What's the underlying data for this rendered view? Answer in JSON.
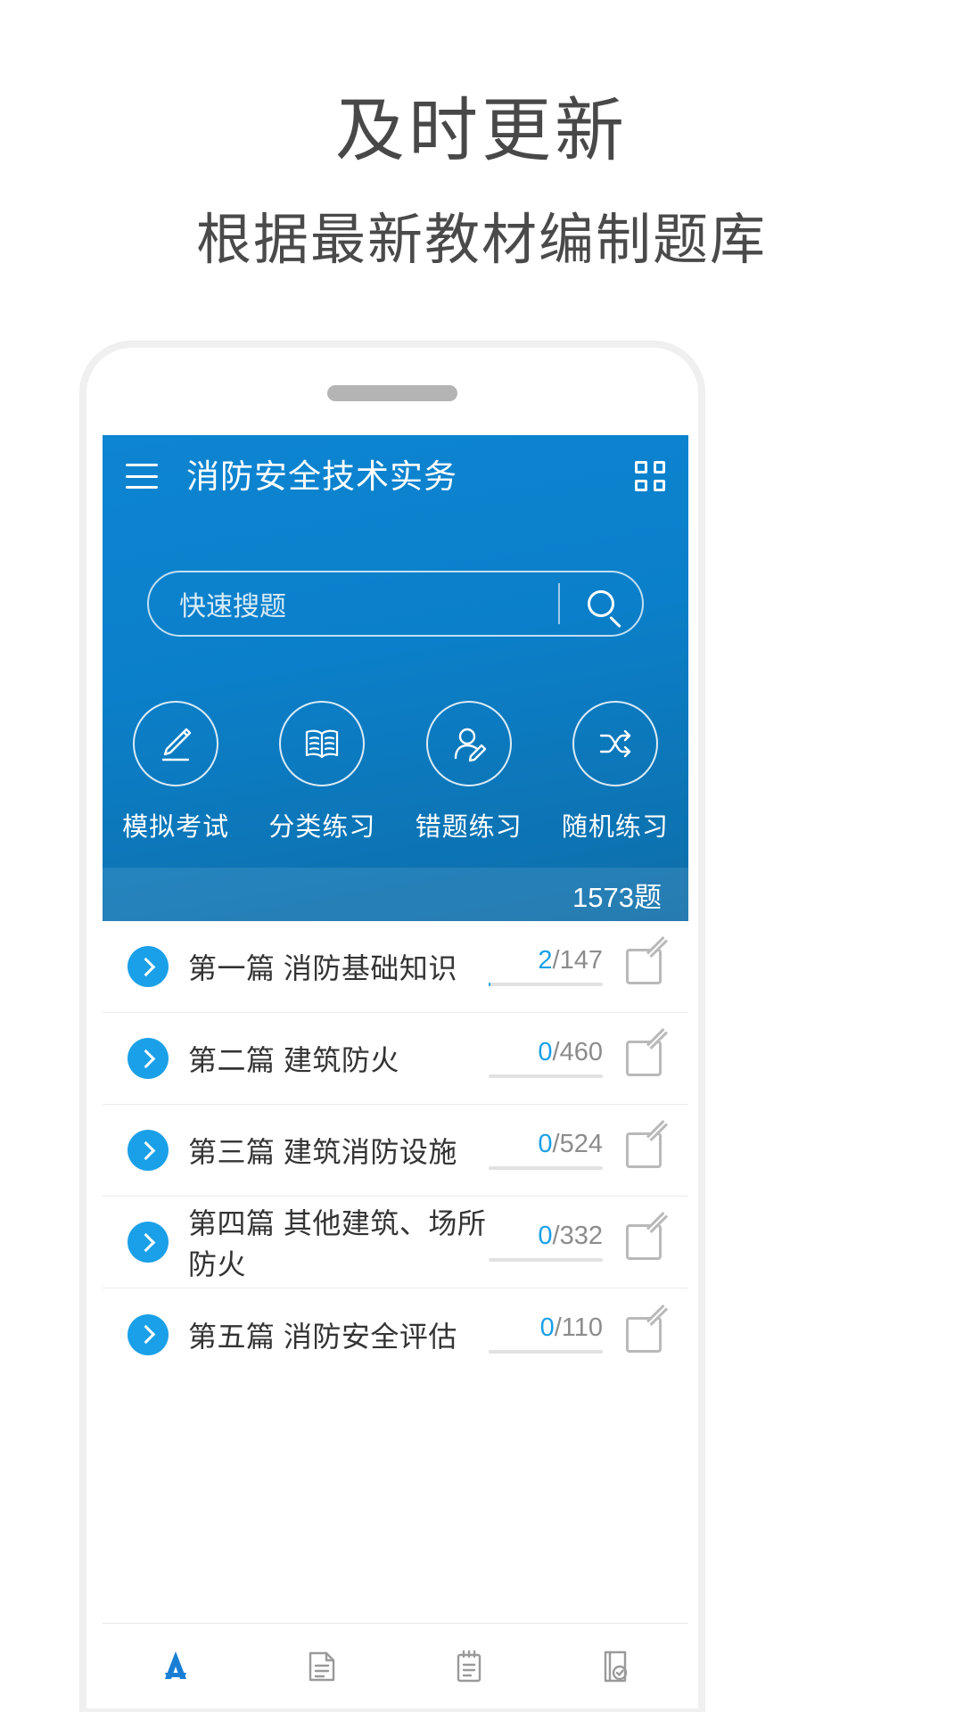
{
  "promo": {
    "title": "及时更新",
    "subtitle": "根据最新教材编制题库"
  },
  "app": {
    "header": {
      "menu_icon": "hamburger-icon",
      "title": "消防安全技术实务",
      "grid_icon": "grid-icon"
    },
    "search": {
      "placeholder": "快速搜题",
      "icon": "search-icon"
    },
    "actions": [
      {
        "label": "模拟考试",
        "icon": "pen-write-icon"
      },
      {
        "label": "分类练习",
        "icon": "open-book-icon"
      },
      {
        "label": "错题练习",
        "icon": "person-edit-icon"
      },
      {
        "label": "随机练习",
        "icon": "shuffle-icon"
      }
    ],
    "total_count": "1573题",
    "chapters": [
      {
        "title": "第一篇 消防基础知识",
        "done": "2",
        "total": "147",
        "percent": 1.4
      },
      {
        "title": "第二篇 建筑防火",
        "done": "0",
        "total": "460",
        "percent": 0
      },
      {
        "title": "第三篇 建筑消防设施",
        "done": "0",
        "total": "524",
        "percent": 0
      },
      {
        "title": "第四篇 其他建筑、场所防火",
        "done": "0",
        "total": "332",
        "percent": 0
      },
      {
        "title": "第五篇 消防安全评估",
        "done": "0",
        "total": "110",
        "percent": 0
      }
    ],
    "tabs": [
      {
        "icon": "app-store-icon",
        "active": true
      },
      {
        "icon": "document-icon",
        "active": false
      },
      {
        "icon": "clipboard-icon",
        "active": false
      },
      {
        "icon": "book-check-icon",
        "active": false
      }
    ]
  },
  "colors": {
    "brand_blue": "#0b7fc9",
    "accent_blue": "#1aa0e8",
    "hero_top": "#0e85d2",
    "hero_bottom": "#0e6ea8"
  }
}
